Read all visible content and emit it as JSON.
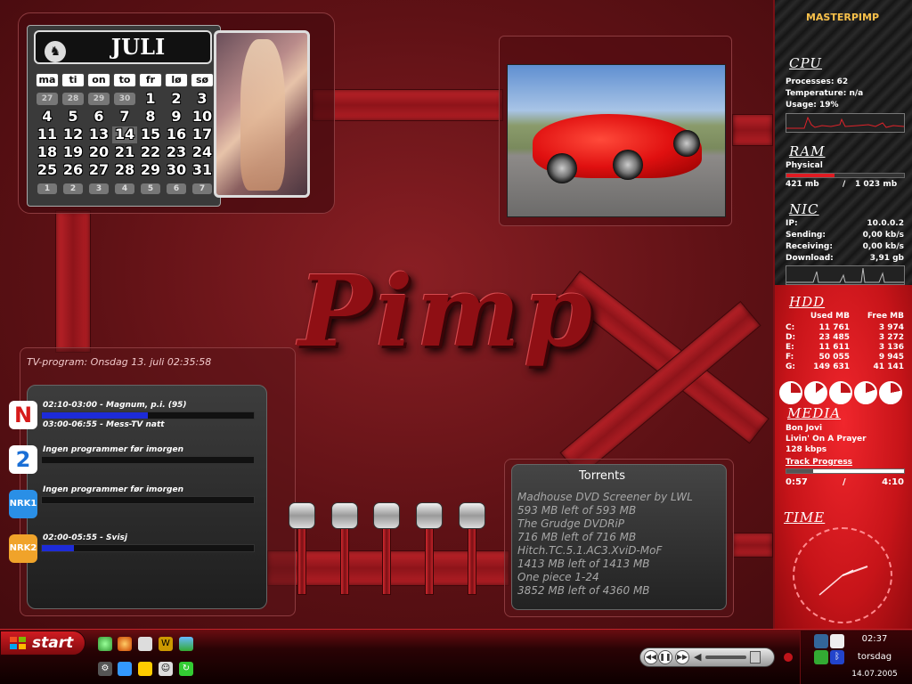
{
  "calendar": {
    "month": "JULI",
    "weekdays": [
      "ma",
      "ti",
      "on",
      "to",
      "fr",
      "lø",
      "sø"
    ],
    "rows": [
      [
        "27",
        "28",
        "29",
        "30",
        "1",
        "2",
        "3"
      ],
      [
        "4",
        "5",
        "6",
        "7",
        "8",
        "9",
        "10"
      ],
      [
        "11",
        "12",
        "13",
        "14",
        "15",
        "16",
        "17"
      ],
      [
        "18",
        "19",
        "20",
        "21",
        "22",
        "23",
        "24"
      ],
      [
        "25",
        "26",
        "27",
        "28",
        "29",
        "30",
        "31"
      ]
    ],
    "weeks": [
      "1",
      "2",
      "3",
      "4",
      "5",
      "6",
      "7"
    ],
    "today": "14"
  },
  "logo_text": "Pimp",
  "tv": {
    "header": "TV-program: Onsdag 13. juli 02:35:58",
    "channels": [
      {
        "logo": "N",
        "logo_bg": "#ffffff",
        "logo_fg": "#d61a1a",
        "lines": [
          "02:10-03:00 - Magnum, p.i. (95)",
          "03:00-06:55 - Mess-TV natt"
        ],
        "progress": 0.5
      },
      {
        "logo": "2",
        "logo_bg": "#ffffff",
        "logo_fg": "#1a6fd6",
        "lines": [
          "Ingen programmer før imorgen"
        ],
        "progress": 0
      },
      {
        "logo": "NRK1",
        "logo_bg": "#2a8fe6",
        "logo_fg": "#ffffff",
        "lines": [
          "Ingen programmer før imorgen"
        ],
        "progress": 0
      },
      {
        "logo": "NRK2",
        "logo_bg": "#f0a32a",
        "logo_fg": "#ffffff",
        "lines": [
          "02:00-05:55 - Svisj"
        ],
        "progress": 0.15
      }
    ]
  },
  "torrents": {
    "title": "Torrents",
    "lines": [
      "Madhouse DVD Screener by LWL",
      "593 MB left of 593 MB",
      "The Grudge DVDRiP",
      "716 MB left of 716 MB",
      "Hitch.TC.5.1.AC3.XviD-MoF",
      "1413 MB left of 1413 MB",
      "One piece 1-24",
      "3852 MB left of 4360 MB"
    ]
  },
  "sidebar": {
    "hostname": "MASTERPIMP",
    "cpu": {
      "title": "CPU",
      "processes": "Processes: 62",
      "temperature": "Temperature: n/a",
      "usage": "Usage: 19%"
    },
    "ram": {
      "title": "RAM",
      "label": "Physical",
      "used": "421 mb",
      "sep": "/",
      "total": "1 023 mb",
      "fraction": 0.41
    },
    "nic": {
      "title": "NIC",
      "rows": [
        {
          "label": "IP:",
          "value": "10.0.0.2"
        },
        {
          "label": "Sending:",
          "value": "0,00 kb/s"
        },
        {
          "label": "Receiving:",
          "value": "0,00 kb/s"
        },
        {
          "label": "Download:",
          "value": "3,91 gb"
        }
      ]
    },
    "hdd": {
      "title": "HDD",
      "col_used": "Used MB",
      "col_free": "Free MB",
      "drives": [
        {
          "drive": "C:",
          "used": "11 761",
          "free": "3 974"
        },
        {
          "drive": "D:",
          "used": "23 485",
          "free": "3 272"
        },
        {
          "drive": "E:",
          "used": "11 611",
          "free": "3 136"
        },
        {
          "drive": "F:",
          "used": "50 055",
          "free": "9 945"
        },
        {
          "drive": "G:",
          "used": "149 631",
          "free": "41 141"
        }
      ]
    },
    "media": {
      "title": "MEDIA",
      "artist": "Bon Jovi",
      "track": "Livin' On A Prayer",
      "bitrate": "128 kbps",
      "progress_label": "Track Progress",
      "elapsed": "0:57",
      "sep": "/",
      "total": "4:10",
      "fraction": 0.23
    },
    "time_title": "TIME"
  },
  "taskbar": {
    "start_label": "start",
    "tray_time": "02:37",
    "tray_day": "torsdag",
    "tray_date": "14.07.2005"
  },
  "colors": {
    "accent": "#c0242a",
    "hostname": "#f7c04a",
    "tv_progress": "#1d2bd8"
  }
}
